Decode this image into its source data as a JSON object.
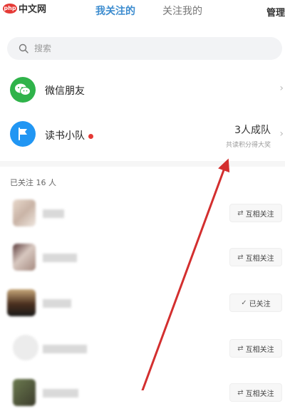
{
  "watermark": {
    "badge": "php",
    "text": "中文网"
  },
  "tabs": [
    {
      "label": "我关注的",
      "active": true
    },
    {
      "label": "关注我的",
      "active": false
    }
  ],
  "manage_label": "管理",
  "search": {
    "placeholder": "搜索"
  },
  "entries": {
    "wechat": {
      "label": "微信朋友"
    },
    "team": {
      "label": "读书小队",
      "count": "3人成队",
      "subtitle": "共读积分得大奖"
    }
  },
  "section_title": "已关注 16 人",
  "users": [
    {
      "button_label": "互相关注",
      "button_glyph": "⇄"
    },
    {
      "button_label": "互相关注",
      "button_glyph": "⇄"
    },
    {
      "button_label": "已关注",
      "button_glyph": "✓"
    },
    {
      "button_label": "互相关注",
      "button_glyph": "⇄"
    },
    {
      "button_label": "互相关注",
      "button_glyph": "⇄"
    }
  ],
  "colors": {
    "accent_tab": "#3c8ccf",
    "wechat_green": "#2fb34a",
    "team_blue": "#2196f3",
    "annotation_arrow": "#d32f2f"
  }
}
